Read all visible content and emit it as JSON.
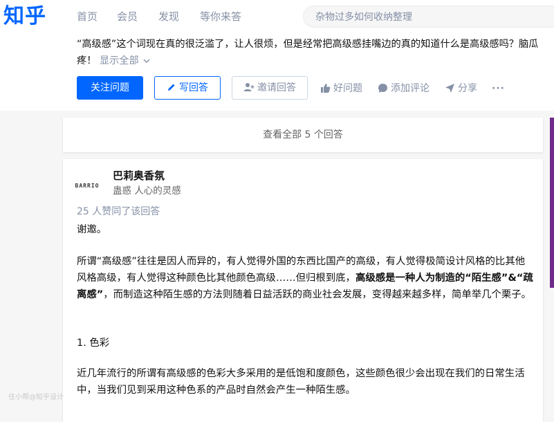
{
  "header": {
    "logo": "知乎",
    "nav": [
      "首页",
      "会员",
      "发现",
      "等你来答"
    ],
    "search_placeholder": "杂物过多如何收纳整理"
  },
  "question": {
    "detail": "“高级感”这个词现在真的很泛滥了，让人很烦，但是经常把高级感挂嘴边的真的知道什么是高级感吗？脑瓜疼！",
    "show_all": "显示全部"
  },
  "actions": {
    "follow": "关注问题",
    "write": "写回答",
    "invite": "邀请回答",
    "good_question": "好问题",
    "comment": "添加评论",
    "share": "分享",
    "more": "···"
  },
  "answers_link": "查看全部 5 个回答",
  "answer": {
    "avatar_text": "BARRIO",
    "author": "巴莉奥香氛",
    "bio": "蛊惑 人心的灵感",
    "votes": "25 人赞同了该回答",
    "p1": "谢邀。",
    "p2_a": "所谓“高级感”往往是因人而异的，有人觉得外国的东西比国产的高级，有人觉得极简设计风格的比其他风格高级，有人觉得这种颜色比其他颜色高级……但归根到底，",
    "p2_bold": "高级感是一种人为制造的“陌生感”&“疏离感”",
    "p2_b": "，而制造这种陌生感的方法则随着日益活跃的商业社会发展，变得越来越多样，简单举几个栗子。",
    "p3": "1. 色彩",
    "p4": "近几年流行的所谓有高级感的色彩大多采用的是低饱和度颜色，这些颜色很少会出现在我们的日常生活中，当我们见到采用这种色系的产品时自然会产生一种陌生感。"
  },
  "watermark": "住小帮@知乎设计",
  "colors": {
    "brand": "#0066ff",
    "muted": "#8590a6",
    "sidebar_accent": "#6f2a8a"
  }
}
